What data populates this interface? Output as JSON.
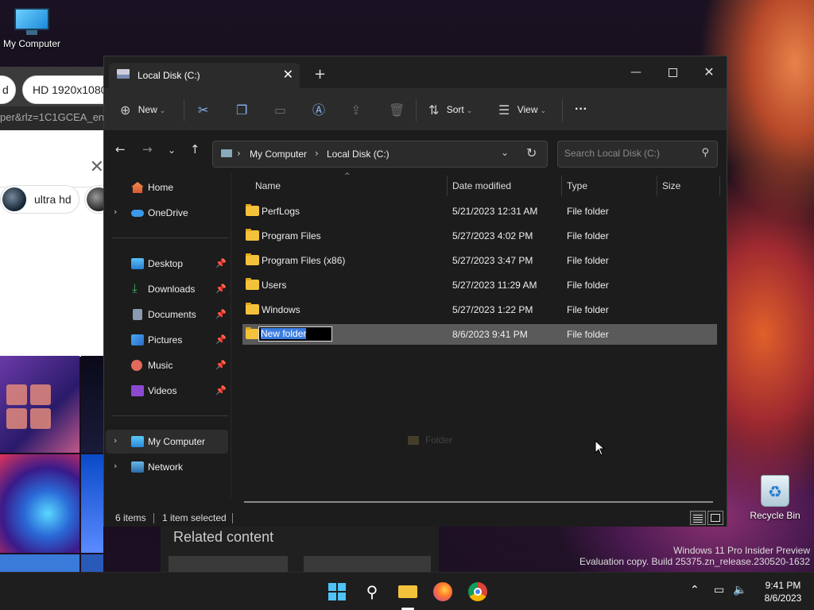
{
  "desktop": {
    "my_computer_label": "My Computer",
    "recycle_bin_label": "Recycle Bin",
    "watermark_line1": "Windows 11 Pro Insider Preview",
    "watermark_line2": "Evaluation copy. Build 25375.zn_release.230520-1632"
  },
  "browser": {
    "url_fragment": "per&rlz=1C1GCEA_en",
    "chips": [
      "d",
      "HD 1920x1080",
      "ultra hd"
    ],
    "related_heading": "Related content"
  },
  "explorer": {
    "tab_title": "Local Disk (C:)",
    "toolbar": {
      "new_label": "New",
      "sort_label": "Sort",
      "view_label": "View",
      "more_label": "···"
    },
    "address": {
      "crumbs": [
        "My Computer",
        "Local Disk (C:)"
      ]
    },
    "search_placeholder": "Search Local Disk (C:)",
    "sidebar": {
      "home": "Home",
      "onedrive": "OneDrive",
      "quick": [
        "Desktop",
        "Downloads",
        "Documents",
        "Pictures",
        "Music",
        "Videos"
      ],
      "my_computer": "My Computer",
      "network": "Network"
    },
    "columns": [
      "Name",
      "Date modified",
      "Type",
      "Size"
    ],
    "rows": [
      {
        "name": "PerfLogs",
        "date": "5/21/2023 12:31 AM",
        "type": "File folder"
      },
      {
        "name": "Program Files",
        "date": "5/27/2023 4:02 PM",
        "type": "File folder"
      },
      {
        "name": "Program Files (x86)",
        "date": "5/27/2023 3:47 PM",
        "type": "File folder"
      },
      {
        "name": "Users",
        "date": "5/27/2023 11:29 AM",
        "type": "File folder"
      },
      {
        "name": "Windows",
        "date": "5/27/2023 1:22 PM",
        "type": "File folder"
      },
      {
        "name": "New folder",
        "date": "8/6/2023 9:41 PM",
        "type": "File folder"
      }
    ],
    "drag_ghost_label": "Folder",
    "status": {
      "items": "6 items",
      "selected": "1 item selected"
    }
  },
  "taskbar": {
    "time": "9:41 PM",
    "date": "8/6/2023"
  }
}
